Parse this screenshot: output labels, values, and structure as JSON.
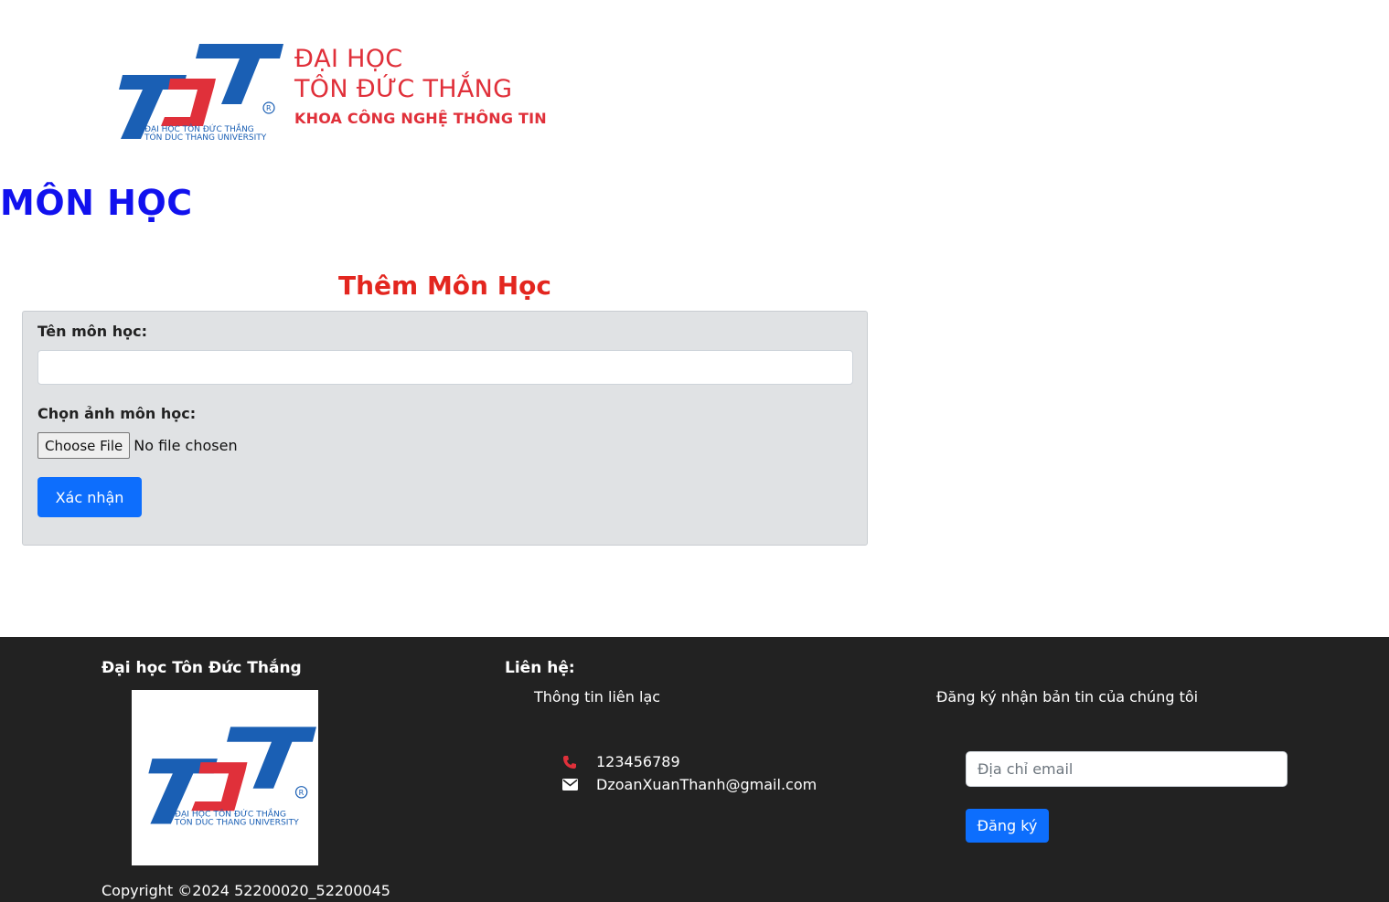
{
  "header": {
    "logo_text_line1": "ĐẠI HỌC TÔN ĐỨC THẮNG",
    "logo_text_line2": "TON DUC THANG UNIVERSITY",
    "brand_line1": "ĐẠI HỌC",
    "brand_line2": "TÔN ĐỨC THẮNG",
    "brand_line3": "KHOA CÔNG NGHỆ THÔNG TIN"
  },
  "page": {
    "title": "MÔN HỌC"
  },
  "form": {
    "title": "Thêm Môn Học",
    "name_label": "Tên môn học:",
    "name_value": "",
    "image_label": "Chọn ảnh môn học:",
    "file_button": "Choose File",
    "file_status": "No file chosen",
    "submit_label": "Xác nhận"
  },
  "footer": {
    "col1_title": "Đại học Tôn Đức Thắng",
    "copyright": "Copyright ©2024 52200020_52200045",
    "col2_title": "Liên hệ:",
    "col2_subtitle": "Thông tin liên lạc",
    "phone": "123456789",
    "email": "DzoanXuanThanh@gmail.com",
    "col3_subtitle": "Đăng ký nhận bản tin của chúng tôi",
    "email_placeholder": "Địa chỉ email",
    "subscribe_label": "Đăng ký"
  },
  "colors": {
    "brand_red": "#e0303a",
    "logo_blue": "#1a5fb4",
    "title_blue": "#1111ee",
    "primary_button": "#0d6efd",
    "footer_bg": "#222222"
  },
  "icons": [
    "tdt-logo",
    "phone-icon",
    "envelope-icon"
  ]
}
